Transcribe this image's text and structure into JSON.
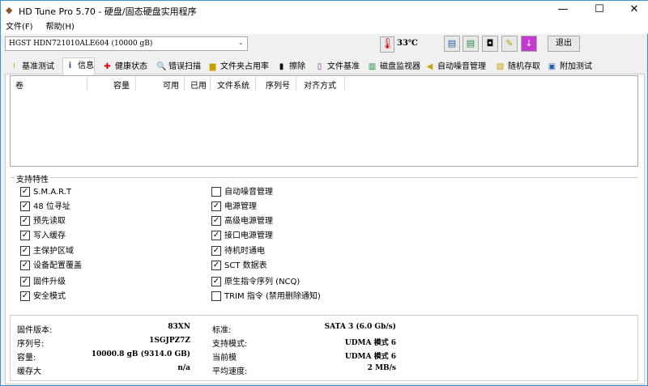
{
  "window": {
    "title": "HD Tune Pro 5.70 - 硬盘/固态硬盘实用程序",
    "minimize": "—",
    "maximize": "☐",
    "close": "✕"
  },
  "menu": [
    "文件(F)",
    "帮助(H)"
  ],
  "toolbar": {
    "drive": "HGST HDN721010ALE604 (10000 gB)",
    "temperature": "33℃",
    "exit": "退出"
  },
  "tabs": [
    "基准测试",
    "信息",
    "健康状态",
    "错误扫描",
    "文件夹占用率",
    "擦除",
    "文件基准",
    "磁盘监视器",
    "自动噪音管理",
    "随机存取",
    "附加测试"
  ],
  "active_tab": "信息",
  "volume_columns": [
    "卷",
    "容量",
    "可用",
    "已用",
    "文件系统",
    "序列号",
    "对齐方式"
  ],
  "features": {
    "title": "支持特性",
    "left": [
      {
        "label": "S.M.A.R.T",
        "checked": true
      },
      {
        "label": "48 位寻址",
        "checked": true
      },
      {
        "label": "预先读取",
        "checked": true
      },
      {
        "label": "写入缓存",
        "checked": true
      },
      {
        "label": "主保护区域",
        "checked": true
      },
      {
        "label": "设备配置覆盖",
        "checked": true
      },
      {
        "label": "固件升级",
        "checked": true
      },
      {
        "label": "安全模式",
        "checked": true
      }
    ],
    "right": [
      {
        "label": "自动噪音管理",
        "checked": false
      },
      {
        "label": "电源管理",
        "checked": true
      },
      {
        "label": "高级电源管理",
        "checked": true
      },
      {
        "label": "接口电源管理",
        "checked": true
      },
      {
        "label": "待机时通电",
        "checked": true
      },
      {
        "label": "SCT 数据表",
        "checked": true
      },
      {
        "label": "原生指令序列 (NCQ)",
        "checked": true
      },
      {
        "label": "TRIM 指令 (禁用删除通知)",
        "checked": false
      }
    ]
  },
  "info": {
    "left": [
      {
        "label": "固件版本:",
        "value": "83XN"
      },
      {
        "label": "序列号:",
        "value": "1SGJPZ7Z"
      },
      {
        "label": "容量:",
        "value": "10000.8 gB (9314.0 GB)"
      },
      {
        "label": "缓存大",
        "value": "n/a"
      }
    ],
    "right": [
      {
        "label": "标准:",
        "value": "SATA 3 (6.0 Gb/s)"
      },
      {
        "label": "支持模式:",
        "value": "UDMA 模式 6"
      },
      {
        "label": "当前模",
        "value": "UDMA 模式 6"
      },
      {
        "label": "平均速度:",
        "value": "2 MB/s"
      }
    ]
  }
}
